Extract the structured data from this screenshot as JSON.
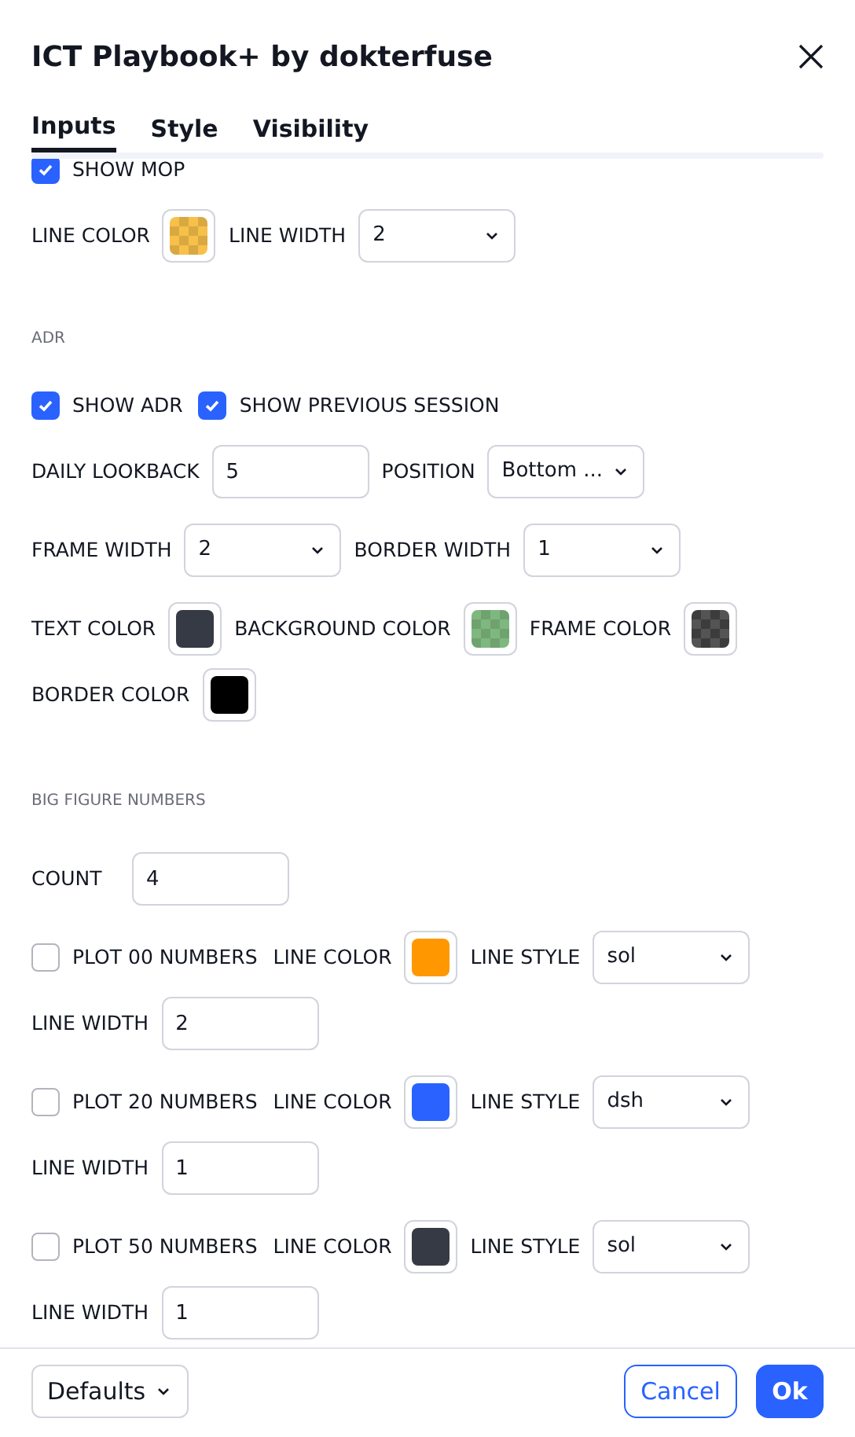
{
  "dialog": {
    "title": "ICT Playbook+ by dokterfuse"
  },
  "tabs": [
    {
      "label": "Inputs",
      "selected": true
    },
    {
      "label": "Style",
      "selected": false
    },
    {
      "label": "Visibility",
      "selected": false
    }
  ],
  "sections": [
    {
      "groups": [
        [
          [
            {
              "kind": "checkbox",
              "label": "SHOW MOP",
              "checked": true
            }
          ],
          [
            {
              "kind": "label",
              "text": "LINE COLOR"
            },
            {
              "kind": "swatch",
              "color": "#f7c04a",
              "checkered": true
            },
            {
              "kind": "label",
              "text": "LINE WIDTH"
            },
            {
              "kind": "select",
              "value": "2"
            }
          ]
        ]
      ]
    },
    {
      "title": "ADR",
      "groups": [
        [
          [
            {
              "kind": "checkbox",
              "label": "SHOW ADR",
              "checked": true
            },
            {
              "kind": "checkbox",
              "label": "SHOW PREVIOUS SESSION",
              "checked": true
            }
          ],
          [
            {
              "kind": "label",
              "text": "DAILY LOOKBACK"
            },
            {
              "kind": "input",
              "value": "5"
            },
            {
              "kind": "label",
              "text": "POSITION"
            },
            {
              "kind": "select",
              "value": "Bottom ..."
            }
          ]
        ],
        [
          [
            {
              "kind": "label",
              "text": "FRAME WIDTH"
            },
            {
              "kind": "select",
              "value": "2"
            },
            {
              "kind": "label",
              "text": "BORDER WIDTH"
            },
            {
              "kind": "select",
              "value": "1"
            }
          ]
        ],
        [
          [
            {
              "kind": "label",
              "text": "TEXT COLOR"
            },
            {
              "kind": "swatch",
              "color": "#363a45",
              "checkered": false
            },
            {
              "kind": "label",
              "text": "BACKGROUND COLOR"
            },
            {
              "kind": "swatch",
              "color": "#7fb87f",
              "checkered": true
            },
            {
              "kind": "label",
              "text": "FRAME COLOR"
            },
            {
              "kind": "swatch",
              "color": "#3c3c3c",
              "checkered": true
            }
          ],
          [
            {
              "kind": "label",
              "text": "BORDER COLOR"
            },
            {
              "kind": "swatch",
              "color": "#000000",
              "checkered": false
            }
          ]
        ]
      ]
    },
    {
      "title": "BIG FIGURE NUMBERS",
      "groups": [
        [
          [
            {
              "kind": "label",
              "text": "COUNT"
            },
            {
              "kind": "input",
              "value": "4"
            }
          ]
        ],
        [
          [
            {
              "kind": "checkbox",
              "label": "PLOT 00 NUMBERS",
              "checked": false
            },
            {
              "kind": "label",
              "text": "LINE COLOR"
            },
            {
              "kind": "swatch",
              "color": "#ff9800",
              "checkered": false
            },
            {
              "kind": "label",
              "text": "LINE STYLE"
            },
            {
              "kind": "select",
              "value": "sol"
            }
          ],
          [
            {
              "kind": "label",
              "text": "LINE WIDTH"
            },
            {
              "kind": "input",
              "value": "2"
            }
          ]
        ],
        [
          [
            {
              "kind": "checkbox",
              "label": "PLOT 20 NUMBERS",
              "checked": false
            },
            {
              "kind": "label",
              "text": "LINE COLOR"
            },
            {
              "kind": "swatch",
              "color": "#2962ff",
              "checkered": false
            },
            {
              "kind": "label",
              "text": "LINE STYLE"
            },
            {
              "kind": "select",
              "value": "dsh"
            }
          ],
          [
            {
              "kind": "label",
              "text": "LINE WIDTH"
            },
            {
              "kind": "input",
              "value": "1"
            }
          ]
        ],
        [
          [
            {
              "kind": "checkbox",
              "label": "PLOT 50 NUMBERS",
              "checked": false
            },
            {
              "kind": "label",
              "text": "LINE COLOR"
            },
            {
              "kind": "swatch",
              "color": "#363a45",
              "checkered": false
            },
            {
              "kind": "label",
              "text": "LINE STYLE"
            },
            {
              "kind": "select",
              "value": "sol"
            }
          ],
          [
            {
              "kind": "label",
              "text": "LINE WIDTH"
            },
            {
              "kind": "input",
              "value": "1"
            }
          ]
        ]
      ]
    }
  ],
  "footer": {
    "defaults": "Defaults",
    "cancel": "Cancel",
    "ok": "Ok"
  }
}
